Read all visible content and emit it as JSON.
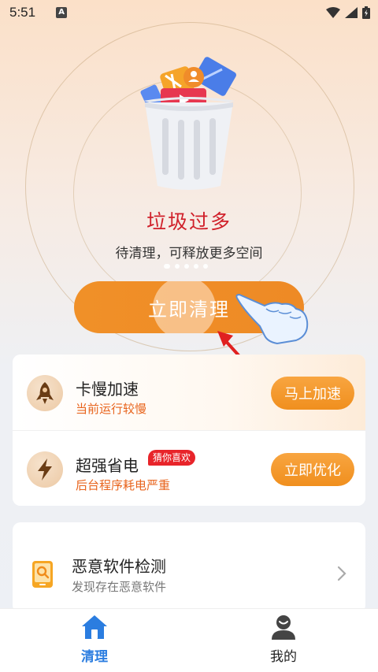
{
  "status_bar": {
    "time": "5:51",
    "notification_badge": "A"
  },
  "hero": {
    "title": "垃圾过多",
    "subtitle": "待清理，可释放更多空间",
    "clean_button": "立即清理",
    "page_indicator": {
      "count": 5,
      "active": 0
    }
  },
  "features": [
    {
      "name": "卡慢加速",
      "desc": "当前运行较慢",
      "button": "马上加速",
      "icon": "rocket-icon"
    },
    {
      "name": "超强省电",
      "badge": "猜你喜欢",
      "desc": "后台程序耗电严重",
      "button": "立即优化",
      "icon": "lightning-icon"
    }
  ],
  "malware": {
    "name": "恶意软件检测",
    "desc": "发现存在恶意软件",
    "icon": "phone-search-icon"
  },
  "nav": {
    "items": [
      {
        "label": "清理",
        "icon": "home-icon",
        "active": true
      },
      {
        "label": "我的",
        "icon": "user-icon",
        "active": false
      }
    ]
  },
  "colors": {
    "accent": "#F09028",
    "alert": "#D0202A",
    "nav_active": "#2B7DE0",
    "warning_text": "#E8641D"
  }
}
